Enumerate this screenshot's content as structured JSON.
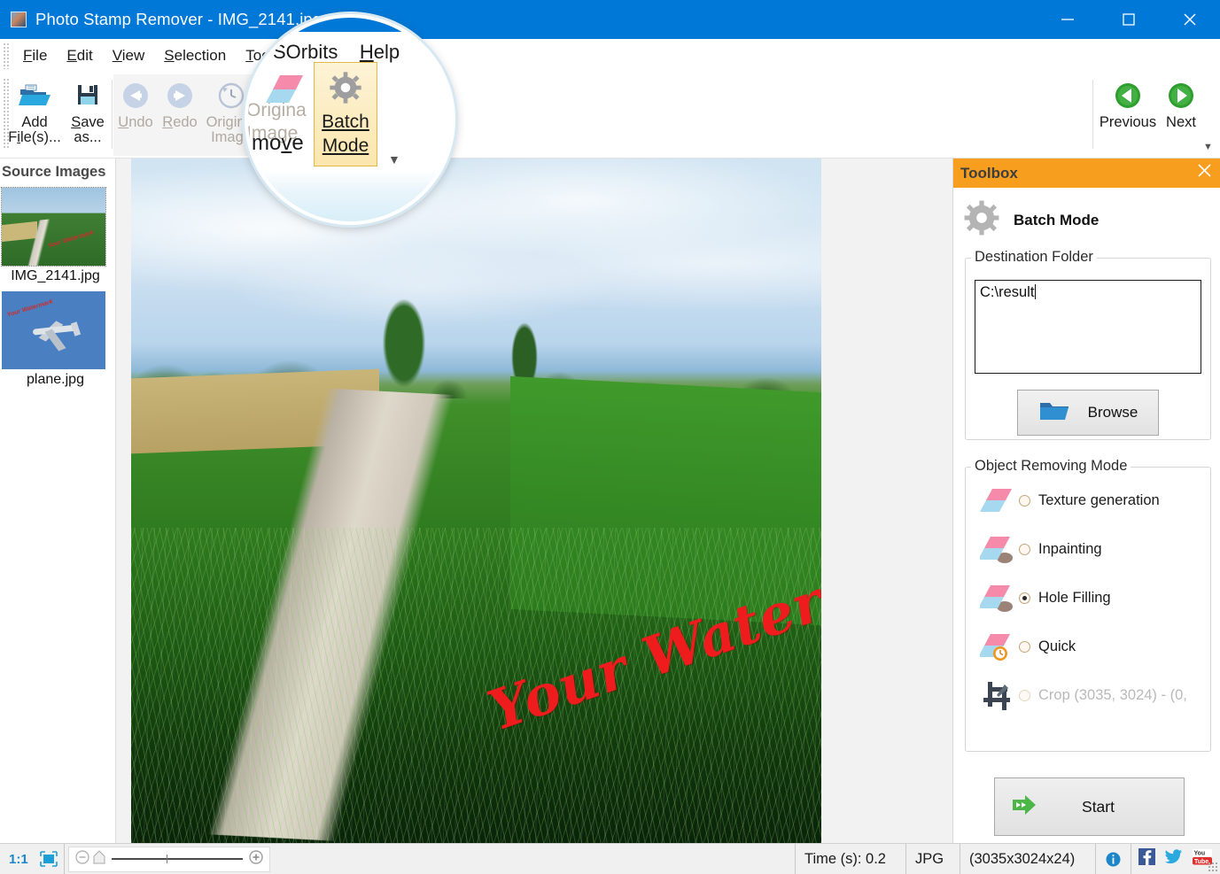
{
  "window": {
    "title": "Photo Stamp Remover - IMG_2141.jpg",
    "app_icon": "app-photo-icon",
    "minimize": "minimize-icon",
    "maximize": "maximize-icon",
    "close": "close-icon"
  },
  "menubar": {
    "items": [
      {
        "label": "File",
        "mnemonic": "F"
      },
      {
        "label": "Edit",
        "mnemonic": "E"
      },
      {
        "label": "View",
        "mnemonic": "V"
      },
      {
        "label": "Selection",
        "mnemonic": "S"
      },
      {
        "label": "Tools",
        "mnemonic": "T"
      },
      {
        "label": "SOrbits",
        "mnemonic": ""
      },
      {
        "label": "Help",
        "mnemonic": "H"
      }
    ]
  },
  "ribbon": {
    "add_files": {
      "line1": "Add",
      "line2": "File(s)...",
      "icon": "open-folder-icon"
    },
    "save_as": {
      "line1": "Save",
      "line2": "as...",
      "icon": "floppy-disk-icon"
    },
    "undo": {
      "label": "Undo",
      "icon": "undo-arrow-icon",
      "disabled": true
    },
    "redo": {
      "label": "Redo",
      "icon": "redo-arrow-icon",
      "disabled": true
    },
    "original_image": {
      "line1": "Original",
      "line2": "Image",
      "icon": "clock-history-icon",
      "disabled": true
    },
    "remove": {
      "label": "Remove",
      "icon": "eraser-icon"
    },
    "batch_mode": {
      "line1": "Batch",
      "line2": "Mode",
      "icon": "gear-icon",
      "selected": true
    },
    "previous": {
      "label": "Previous",
      "icon": "green-left-arrow-icon"
    },
    "next": {
      "label": "Next",
      "icon": "green-right-arrow-icon"
    },
    "overflow": "ribbon-overflow-icon"
  },
  "magnifier": {
    "menu_partial": "SOrbits",
    "menu_help": "Help",
    "left_text_line1": "Origina",
    "left_text_line2": "Image",
    "remove_partial": "move",
    "batch_line1": "Batch",
    "batch_line2": "Mode"
  },
  "source_panel": {
    "title": "Source Images",
    "items": [
      {
        "label": "IMG_2141.jpg",
        "selected": true
      },
      {
        "label": "plane.jpg",
        "selected": false
      }
    ]
  },
  "canvas": {
    "watermark_text": "Your Watermark"
  },
  "toolbox": {
    "header_title": "Toolbox",
    "close_icon": "close-icon",
    "mode_title": "Batch Mode",
    "mode_icon": "gear-icon",
    "destination": {
      "legend": "Destination Folder",
      "value": "C:\\result",
      "browse_label": "Browse",
      "browse_icon": "folder-icon"
    },
    "object_removing_mode": {
      "legend": "Object Removing Mode",
      "options": [
        {
          "label": "Texture generation",
          "selected": false,
          "disabled": false,
          "icon": "eraser-icon"
        },
        {
          "label": "Inpainting",
          "selected": false,
          "disabled": false,
          "icon": "eraser-shadow-icon"
        },
        {
          "label": "Hole Filling",
          "selected": true,
          "disabled": false,
          "icon": "eraser-shadow-icon"
        },
        {
          "label": "Quick",
          "selected": false,
          "disabled": false,
          "icon": "eraser-clock-icon"
        },
        {
          "label": "Crop (3035, 3024) - (0,",
          "selected": false,
          "disabled": true,
          "icon": "crop-icon"
        }
      ]
    },
    "start": {
      "label": "Start",
      "icon": "green-double-arrow-icon"
    }
  },
  "statusbar": {
    "zoom_ratio": "1:1",
    "fit_icon": "fit-to-window-icon",
    "zoom_out_icon": "zoom-out-icon",
    "zoom_in_icon": "zoom-in-icon",
    "time_label": "Time (s): 0.2",
    "format": "JPG",
    "dimensions": "(3035x3024x24)",
    "info_icon": "info-icon",
    "facebook_icon": "facebook-icon",
    "twitter_icon": "twitter-icon",
    "youtube_icon": "youtube-icon"
  },
  "colors": {
    "titlebar": "#0078d7",
    "toolbox_header": "#f79e1f",
    "watermark": "#ee1c1c",
    "accent_green": "#3f9a2b",
    "selected_button": "#fbe6ae"
  }
}
